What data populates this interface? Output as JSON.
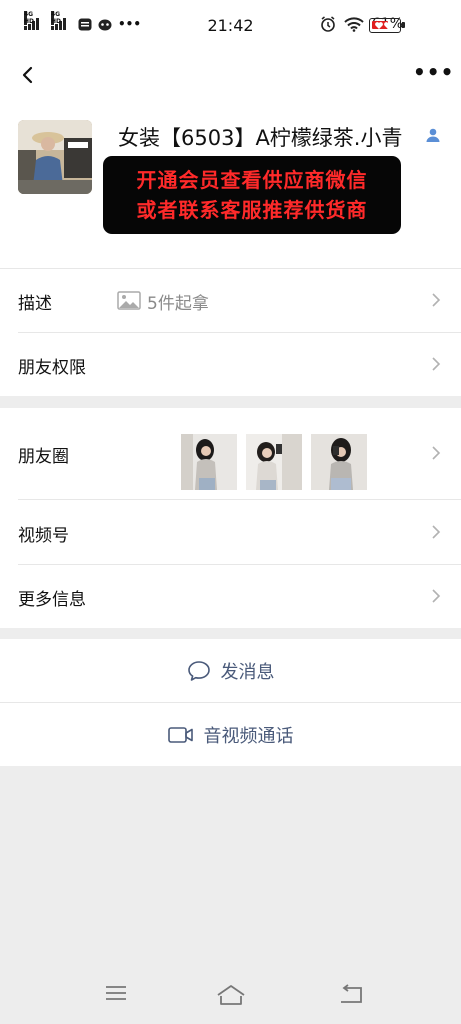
{
  "status_bar": {
    "network_1": "4G HD",
    "network_2": "4G HD",
    "time": "21:42",
    "battery_percent": "61%",
    "battery_level": 0.61,
    "icons": [
      "signal-icon",
      "signal-icon",
      "message-icon",
      "app-icon",
      "more-notifications-icon",
      "alarm-icon",
      "wifi-icon",
      "battery-icon"
    ]
  },
  "nav": {
    "back_icon": "back-arrow-icon",
    "more_icon": "more-dots-icon",
    "more_text": "•••"
  },
  "profile": {
    "name": "女装【6503】A柠檬绿茶.小青",
    "gender_icon": "person-icon",
    "promo_line1": "开通会员查看供应商微信",
    "promo_line2": "或者联系客服推荐供货商"
  },
  "rows": {
    "description": {
      "label": "描述",
      "value": "5件起拿",
      "icon": "image-icon"
    },
    "friend_permissions": {
      "label": "朋友权限"
    },
    "moments": {
      "label": "朋友圈"
    },
    "channels": {
      "label": "视频号"
    },
    "more_info": {
      "label": "更多信息"
    }
  },
  "actions": {
    "message": {
      "label": "发消息",
      "icon": "chat-bubble-icon"
    },
    "call": {
      "label": "音视频通话",
      "icon": "video-camera-icon"
    }
  },
  "system_nav": [
    "menu-icon",
    "home-icon",
    "back-icon"
  ],
  "colors": {
    "accent_text": "#4a5a7a",
    "promo_bg": "#060606",
    "promo_text": "#ff2a2a",
    "page_bg": "#ededed"
  }
}
